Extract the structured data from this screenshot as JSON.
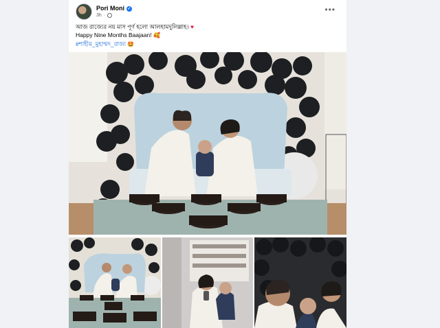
{
  "post": {
    "author": "Pori Moni",
    "time": "3h",
    "more_label": "•••",
    "caption_line1": "আজ রাজ্যের নয় মাস পূর্ণ হলো আলহামদুলিল্লাহ।",
    "caption_line2": "Happy Nine Months Baajaan!",
    "hashtag": "#শাহীম_মুহাম্মদ_রাজ্য",
    "heart": "♥",
    "emoji_face": "🥰",
    "emoji_baby": "🤩"
  },
  "colors": {
    "accent": "#1877f2",
    "hashtag": "#216fdb",
    "page_bg": "#f0f2f5"
  }
}
